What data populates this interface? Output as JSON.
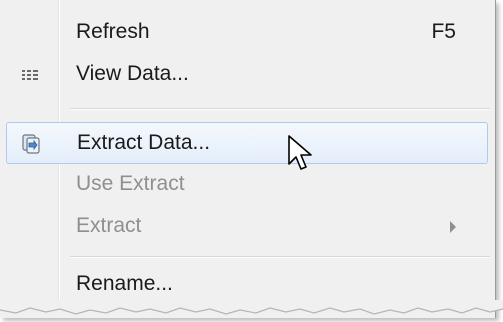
{
  "context_menu": {
    "items": [
      {
        "label": "Refresh",
        "shortcut": "F5",
        "icon": "",
        "enabled": true
      },
      {
        "label": "View Data...",
        "shortcut": "",
        "icon": "view-data-grid-icon",
        "enabled": true
      },
      {
        "label": "Extract Data...",
        "shortcut": "",
        "icon": "extract-data-icon",
        "enabled": true,
        "hovered": true
      },
      {
        "label": "Use Extract",
        "shortcut": "",
        "icon": "",
        "enabled": false
      },
      {
        "label": "Extract",
        "shortcut": "",
        "icon": "",
        "enabled": false,
        "submenu": true
      },
      {
        "label": "Rename...",
        "shortcut": "",
        "icon": "",
        "enabled": true
      }
    ]
  },
  "colors": {
    "menu_background": "#f0f0f0",
    "hover_border": "#aecbef",
    "disabled_text": "#8f8f8f",
    "text": "#1a1a1a"
  }
}
